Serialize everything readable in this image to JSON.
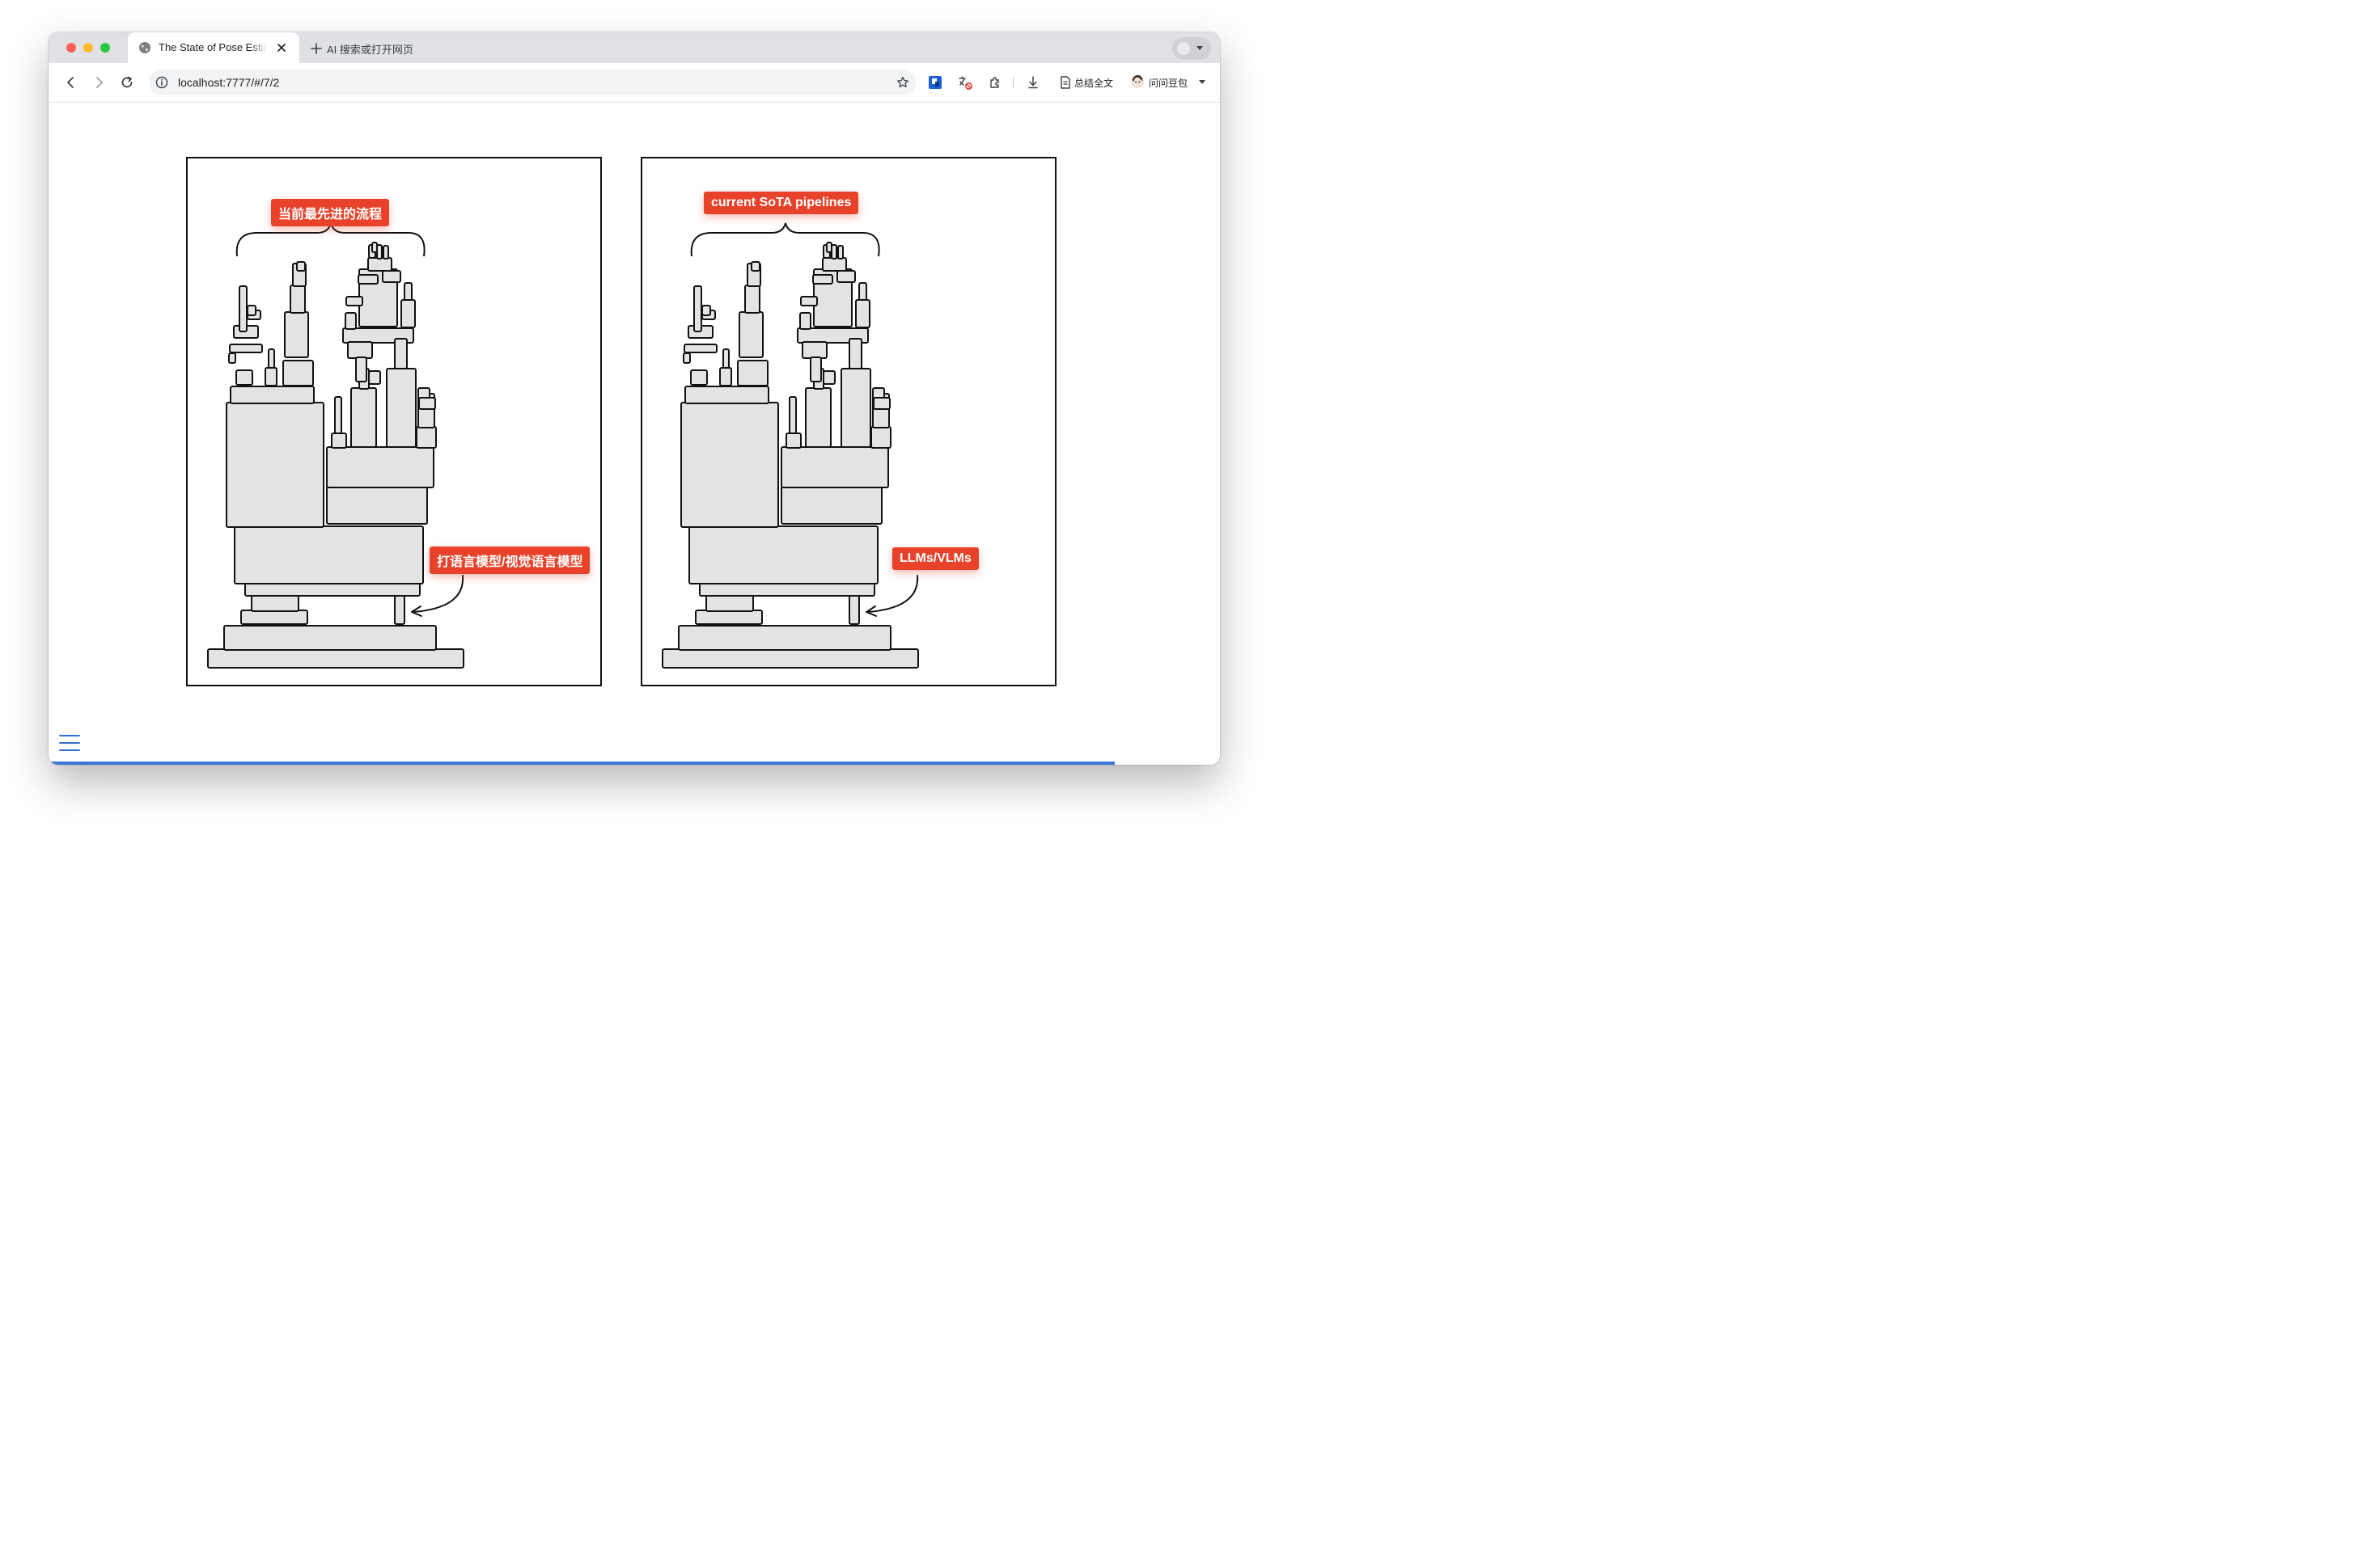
{
  "browser": {
    "tab": {
      "title": "The State of Pose Estimation"
    },
    "new_tab_label": "AI 搜索或打开网页",
    "url": "localhost:7777/#/7/2",
    "toolbar_summarize_label": "总结全文",
    "toolbar_assistant_label": "问问豆包"
  },
  "slide": {
    "left_panel": {
      "top_label": "当前最先进的流程",
      "bottom_label": "打语言模型/视觉语言模型"
    },
    "right_panel": {
      "top_label": "current SoTA pipelines",
      "bottom_label": "LLMs/VLMs"
    },
    "progress_fraction": 0.91
  },
  "colors": {
    "accent_tag": "#e8432a",
    "progress_bar": "#3a78d8",
    "block_fill": "#e3e3e3",
    "block_stroke": "#111111"
  },
  "icons": {
    "tab_favicon": "globe-icon",
    "tab_close": "close-icon",
    "new_tab": "plus-icon",
    "back": "back-arrow-icon",
    "forward": "forward-arrow-icon",
    "reload": "reload-icon",
    "site_info": "info-icon",
    "bookmark": "star-icon",
    "menu": "hamburger-menu-icon"
  }
}
